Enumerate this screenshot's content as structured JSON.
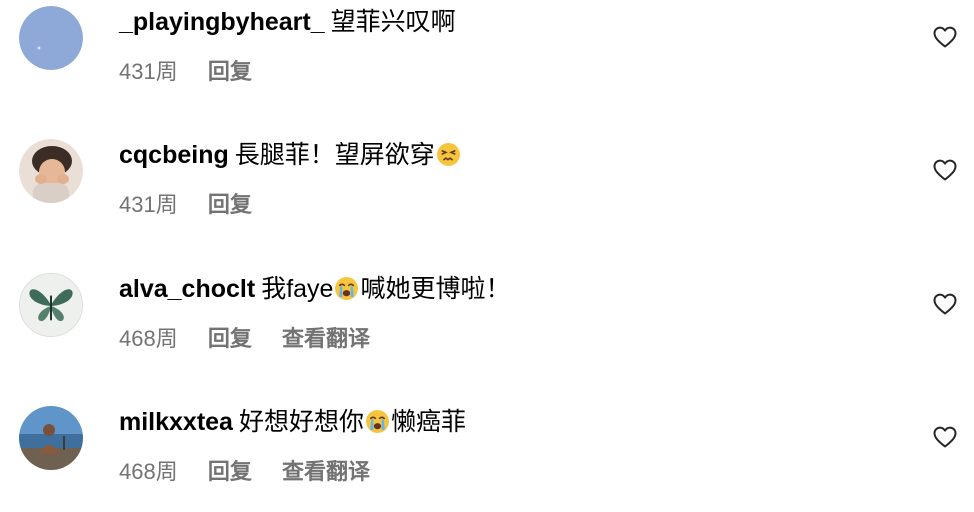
{
  "comments": [
    {
      "username": "_playingbyheart_",
      "text": "望菲兴叹啊",
      "emoji": "",
      "text_after": "",
      "age": "431周",
      "reply": "回复",
      "translate": ""
    },
    {
      "username": "cqcbeing",
      "text": "長腿菲！望屏欲穿",
      "emoji": "confounded-face",
      "text_after": "",
      "age": "431周",
      "reply": "回复",
      "translate": ""
    },
    {
      "username": "alva_choclt",
      "text": "我faye",
      "emoji": "crying-face",
      "text_after": "喊她更博啦！",
      "age": "468周",
      "reply": "回复",
      "translate": "查看翻译"
    },
    {
      "username": "milkxxtea",
      "text": "好想好想你",
      "emoji": "crying-face",
      "text_after": "懒癌菲",
      "age": "468周",
      "reply": "回复",
      "translate": "查看翻译"
    }
  ],
  "colors": {
    "meta_text": "#737373",
    "heart_stroke": "#262626"
  },
  "icons": {
    "like": "heart-outline-icon",
    "emoji_confounded": "confounded-face-emoji",
    "emoji_crying": "loudly-crying-face-emoji"
  }
}
